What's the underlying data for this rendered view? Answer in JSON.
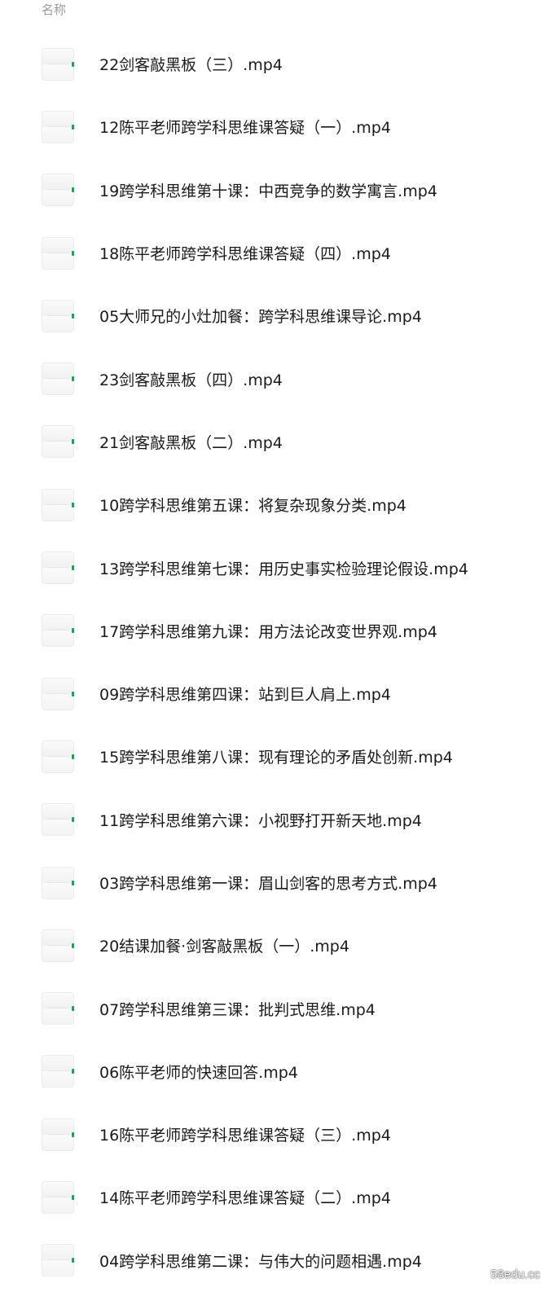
{
  "header": {
    "name_column": "名称"
  },
  "files": [
    {
      "name": "22剑客敲黑板（三）.mp4"
    },
    {
      "name": "12陈平老师跨学科思维课答疑（一）.mp4"
    },
    {
      "name": "19跨学科思维第十课：中西竞争的数学寓言.mp4"
    },
    {
      "name": "18陈平老师跨学科思维课答疑（四）.mp4"
    },
    {
      "name": "05大师兄的小灶加餐：跨学科思维课导论.mp4"
    },
    {
      "name": "23剑客敲黑板（四）.mp4"
    },
    {
      "name": "21剑客敲黑板（二）.mp4"
    },
    {
      "name": "10跨学科思维第五课：将复杂现象分类.mp4"
    },
    {
      "name": "13跨学科思维第七课：用历史事实检验理论假设.mp4"
    },
    {
      "name": "17跨学科思维第九课：用方法论改变世界观.mp4"
    },
    {
      "name": "09跨学科思维第四课：站到巨人肩上.mp4"
    },
    {
      "name": "15跨学科思维第八课：现有理论的矛盾处创新.mp4"
    },
    {
      "name": "11跨学科思维第六课：小视野打开新天地.mp4"
    },
    {
      "name": "03跨学科思维第一课：眉山剑客的思考方式.mp4"
    },
    {
      "name": "20结课加餐·剑客敲黑板（一）.mp4"
    },
    {
      "name": "07跨学科思维第三课：批判式思维.mp4"
    },
    {
      "name": "06陈平老师的快速回答.mp4"
    },
    {
      "name": "16陈平老师跨学科思维课答疑（三）.mp4"
    },
    {
      "name": "14陈平老师跨学科思维课答疑（二）.mp4"
    },
    {
      "name": "04跨学科思维第二课：与伟大的问题相遇.mp4"
    }
  ],
  "watermark": "58edu.cc",
  "colors": {
    "header_text": "#9a9a9a",
    "file_text": "#1a1a1a",
    "icon_accent": "#19a35a"
  }
}
